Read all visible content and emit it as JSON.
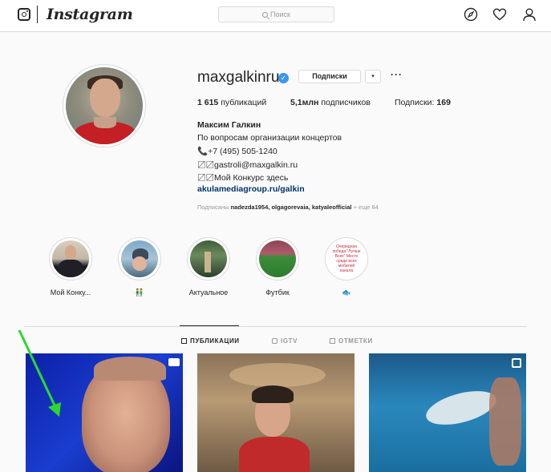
{
  "header": {
    "logo_text": "Instagram",
    "search_placeholder": "Поиск",
    "icons": [
      "explore-icon",
      "heart-icon",
      "profile-icon"
    ]
  },
  "profile": {
    "username": "maxgalkinru",
    "verified": true,
    "subscribe_label": "Подписки",
    "dropdown_label": "▾",
    "more_label": "···",
    "stats": {
      "posts_count": "1 615",
      "posts_label": "публикаций",
      "followers_count": "5,1млн",
      "followers_label": "подписчиков",
      "following_label": "Подписки:",
      "following_count": "169"
    },
    "bio": {
      "name": "Максим Галкин",
      "line1": "По вопросам организации концертов",
      "line2": "📞+7 (495) 505-1240",
      "line3": "〼〼gastroli@maxgalkin.ru",
      "line4": "〼〼Мой Конкурс здесь",
      "link": "akulamediagroup.ru/galkin"
    },
    "followed_by": {
      "prefix": "Подписаны",
      "users": "nadezda1954, olgagorevaia, katyaleofficial",
      "suffix": "+ еще 84"
    }
  },
  "highlights": [
    {
      "label": "Мой Конку..."
    },
    {
      "label": "👬"
    },
    {
      "label": "Актуальное"
    },
    {
      "label": "Футбик"
    },
    {
      "label": "🐟",
      "inner_text": "Очередная победа \"Лучше Всех\" Место среди всех мобилей канала"
    }
  ],
  "tabs": [
    {
      "label": "ПУБЛИКАЦИИ",
      "active": true
    },
    {
      "label": "IGTV",
      "active": false
    },
    {
      "label": "ОТМЕТКИ",
      "active": false
    }
  ],
  "colors": {
    "accent": "#3897f0",
    "link": "#003569",
    "arrow": "#2bd92b"
  }
}
